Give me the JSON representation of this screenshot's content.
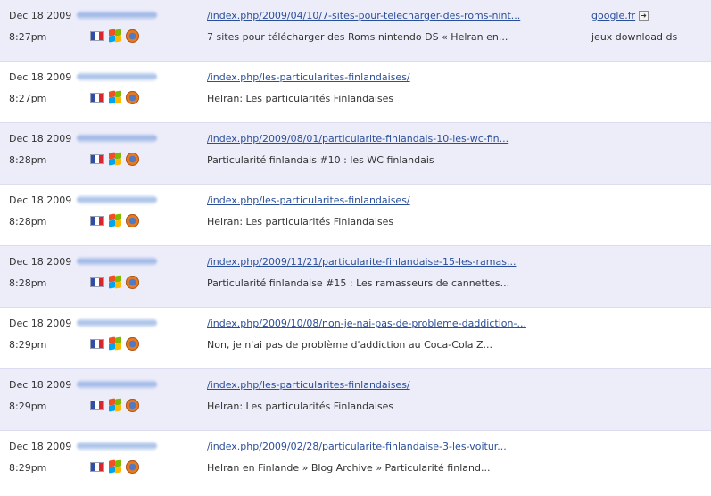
{
  "colors": {
    "row_shaded": "#ededfa",
    "row_plain": "#ffffff",
    "link": "#2a4f9a",
    "text": "#333333",
    "separator": "#dcdcf0"
  },
  "icons": {
    "country": "france-flag-icon",
    "os": "windows-icon",
    "browser": "firefox-icon",
    "external": "external-link-icon"
  },
  "rows": [
    {
      "date": "Dec 18 2009",
      "time": "8:27pm",
      "url": "/index.php/2009/04/10/7-sites-pour-telecharger-des-roms-nint...",
      "title": "7 sites pour télécharger des Roms nintendo DS « Helran en...",
      "referrer": "google.fr",
      "keywords": "jeux download ds"
    },
    {
      "date": "Dec 18 2009",
      "time": "8:27pm",
      "url": "/index.php/les-particularites-finlandaises/",
      "title": "Helran: Les particularités Finlandaises"
    },
    {
      "date": "Dec 18 2009",
      "time": "8:28pm",
      "url": "/index.php/2009/08/01/particularite-finlandais-10-les-wc-fin...",
      "title": "Particularité finlandais #10 : les WC finlandais"
    },
    {
      "date": "Dec 18 2009",
      "time": "8:28pm",
      "url": "/index.php/les-particularites-finlandaises/",
      "title": "Helran: Les particularités Finlandaises"
    },
    {
      "date": "Dec 18 2009",
      "time": "8:28pm",
      "url": "/index.php/2009/11/21/particularite-finlandaise-15-les-ramas...",
      "title": "Particularité finlandaise #15 : Les ramasseurs de cannettes..."
    },
    {
      "date": "Dec 18 2009",
      "time": "8:29pm",
      "url": "/index.php/2009/10/08/non-je-nai-pas-de-probleme-daddiction-...",
      "title": "Non, je n'ai pas de problème d'addiction au Coca-Cola Z..."
    },
    {
      "date": "Dec 18 2009",
      "time": "8:29pm",
      "url": "/index.php/les-particularites-finlandaises/",
      "title": "Helran: Les particularités Finlandaises"
    },
    {
      "date": "Dec 18 2009",
      "time": "8:29pm",
      "url": "/index.php/2009/02/28/particularite-finlandaise-3-les-voitur...",
      "title": "Helran en Finlande » Blog Archive » Particularité finland..."
    }
  ]
}
